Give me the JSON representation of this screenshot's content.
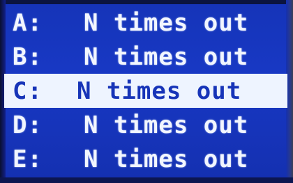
{
  "menu": {
    "items": [
      {
        "letter": "A:",
        "text": "N times out"
      },
      {
        "letter": "B:",
        "text": "N times out"
      },
      {
        "letter": "C:",
        "text": "N times out"
      },
      {
        "letter": "D:",
        "text": "N times out"
      },
      {
        "letter": "E:",
        "text": "N times out"
      }
    ],
    "selected_index": 2
  },
  "colors": {
    "background": "#1838c4",
    "text": "#f2f6ff",
    "highlight_background": "#eef4ff",
    "highlight_text": "#1734b8"
  }
}
